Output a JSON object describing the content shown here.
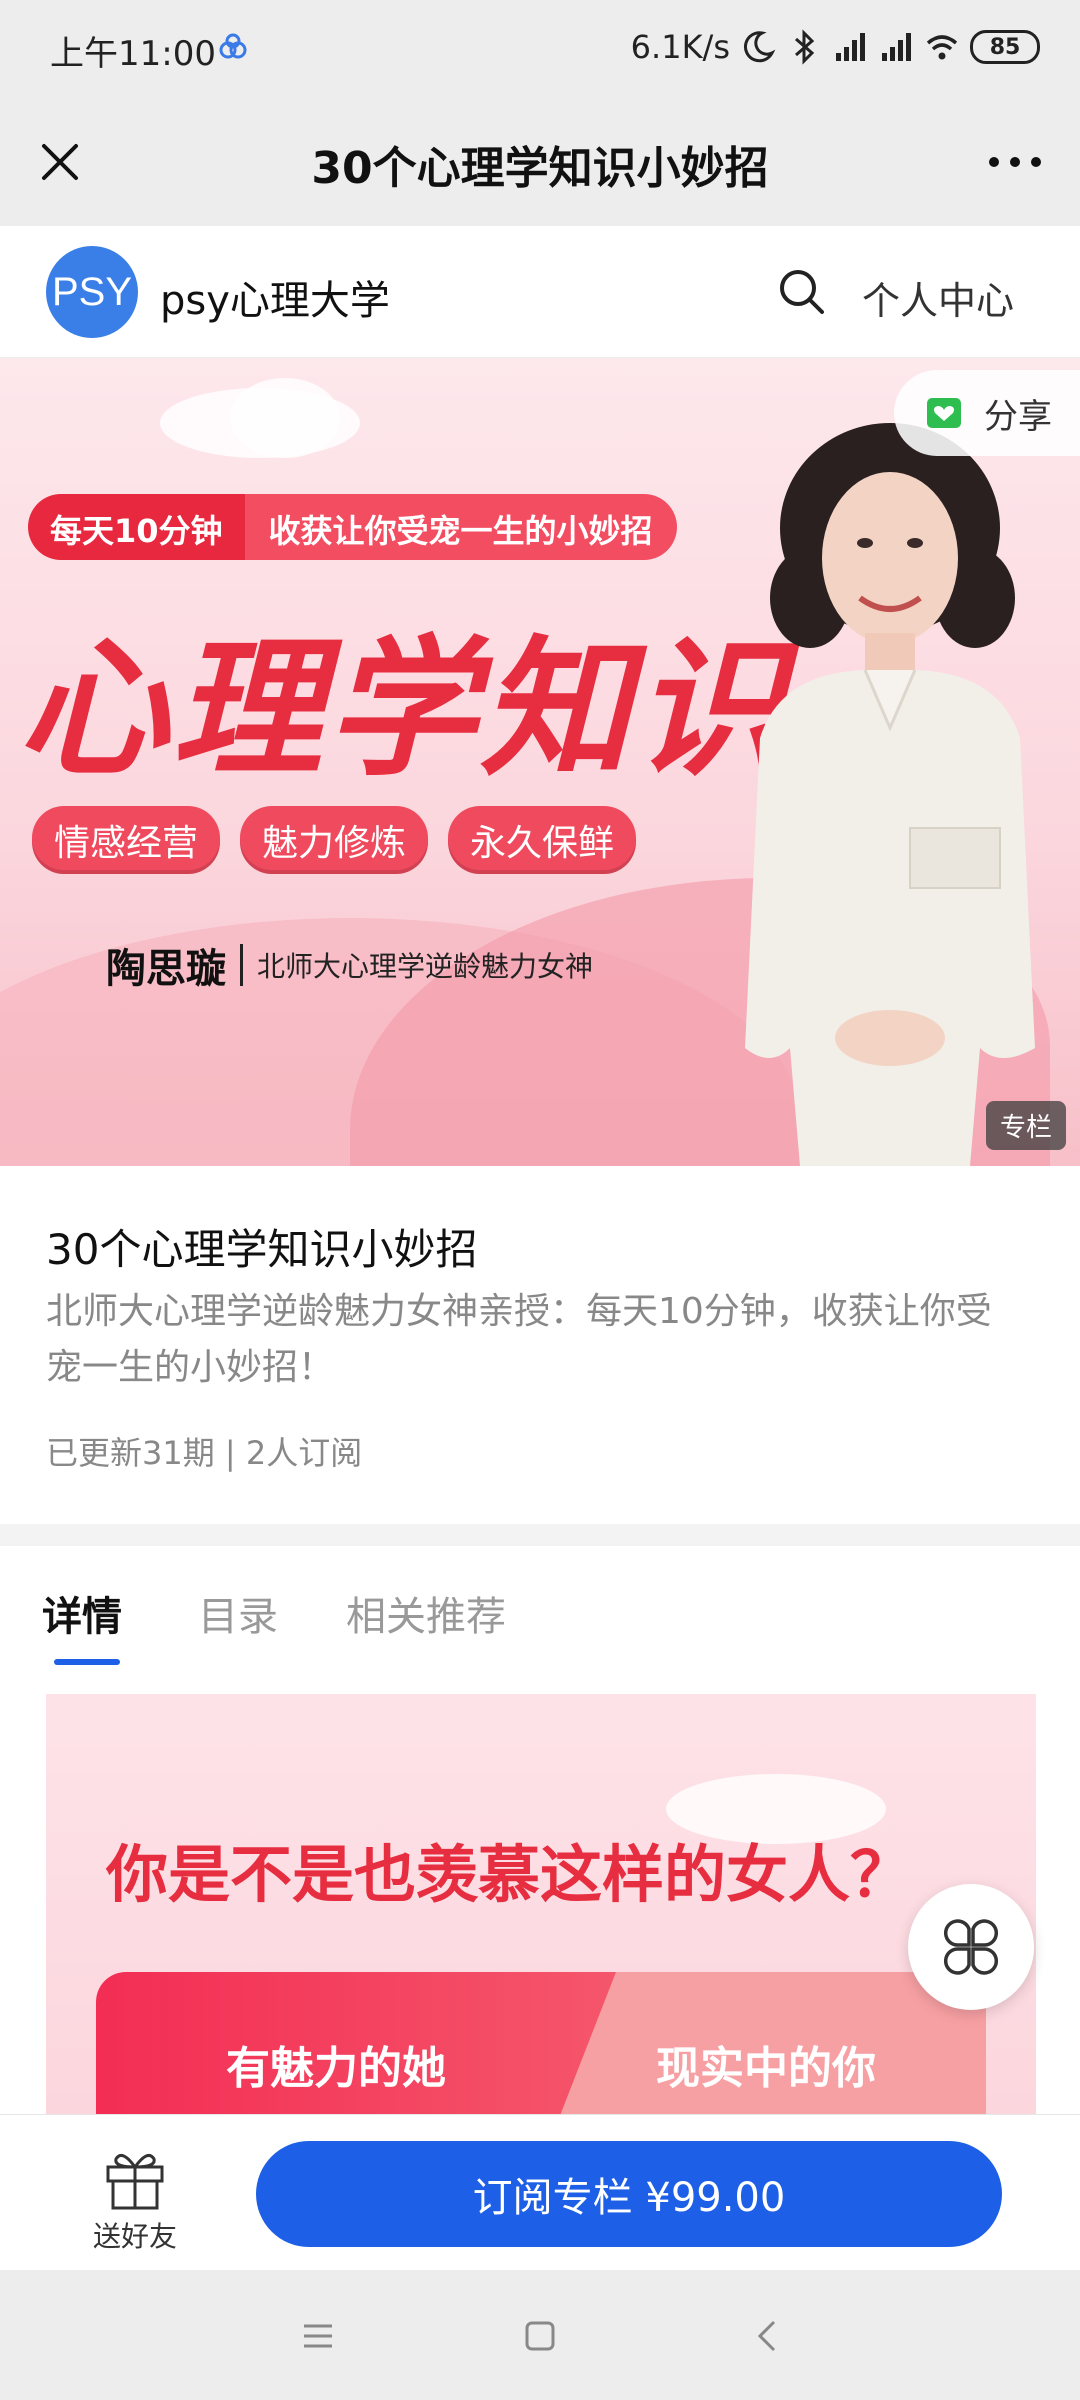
{
  "status_bar": {
    "time": "上午11:00",
    "net_speed": "6.1K/s",
    "battery": "85"
  },
  "header": {
    "title": "30个心理学知识小妙招",
    "close_icon": "close-icon",
    "more_icon": "more-icon"
  },
  "brand": {
    "logo_text": "PSY",
    "name": "psy心理大学",
    "search_icon": "search-icon",
    "personal_center": "个人中心"
  },
  "banner": {
    "slogan_part1": "每天10分钟",
    "slogan_part2": "收获让你受宠一生的小妙招",
    "headline": "心理学知识",
    "tags": [
      "情感经营",
      "魅力修炼",
      "永久保鲜"
    ],
    "author_name": "陶思璇",
    "author_desc": "北师大心理学逆龄魅力女神",
    "share_label": "分享",
    "badge": "专栏"
  },
  "course": {
    "title": "30个心理学知识小妙招",
    "description": "北师大心理学逆龄魅力女神亲授：每天10分钟，收获让你受宠一生的小妙招！",
    "meta": "已更新31期 | 2人订阅"
  },
  "tabs": [
    {
      "label": "详情",
      "active": true
    },
    {
      "label": "目录",
      "active": false
    },
    {
      "label": "相关推荐",
      "active": false
    }
  ],
  "content": {
    "headline": "你是不是也羡慕这样的女人？",
    "left_label": "有魅力的她",
    "right_label": "现实中的你"
  },
  "bottom": {
    "gift_label": "送好友",
    "subscribe_label": "订阅专栏 ¥99.00"
  },
  "colors": {
    "accent": "#1d5fe6",
    "banner_red": "#e72d40"
  }
}
